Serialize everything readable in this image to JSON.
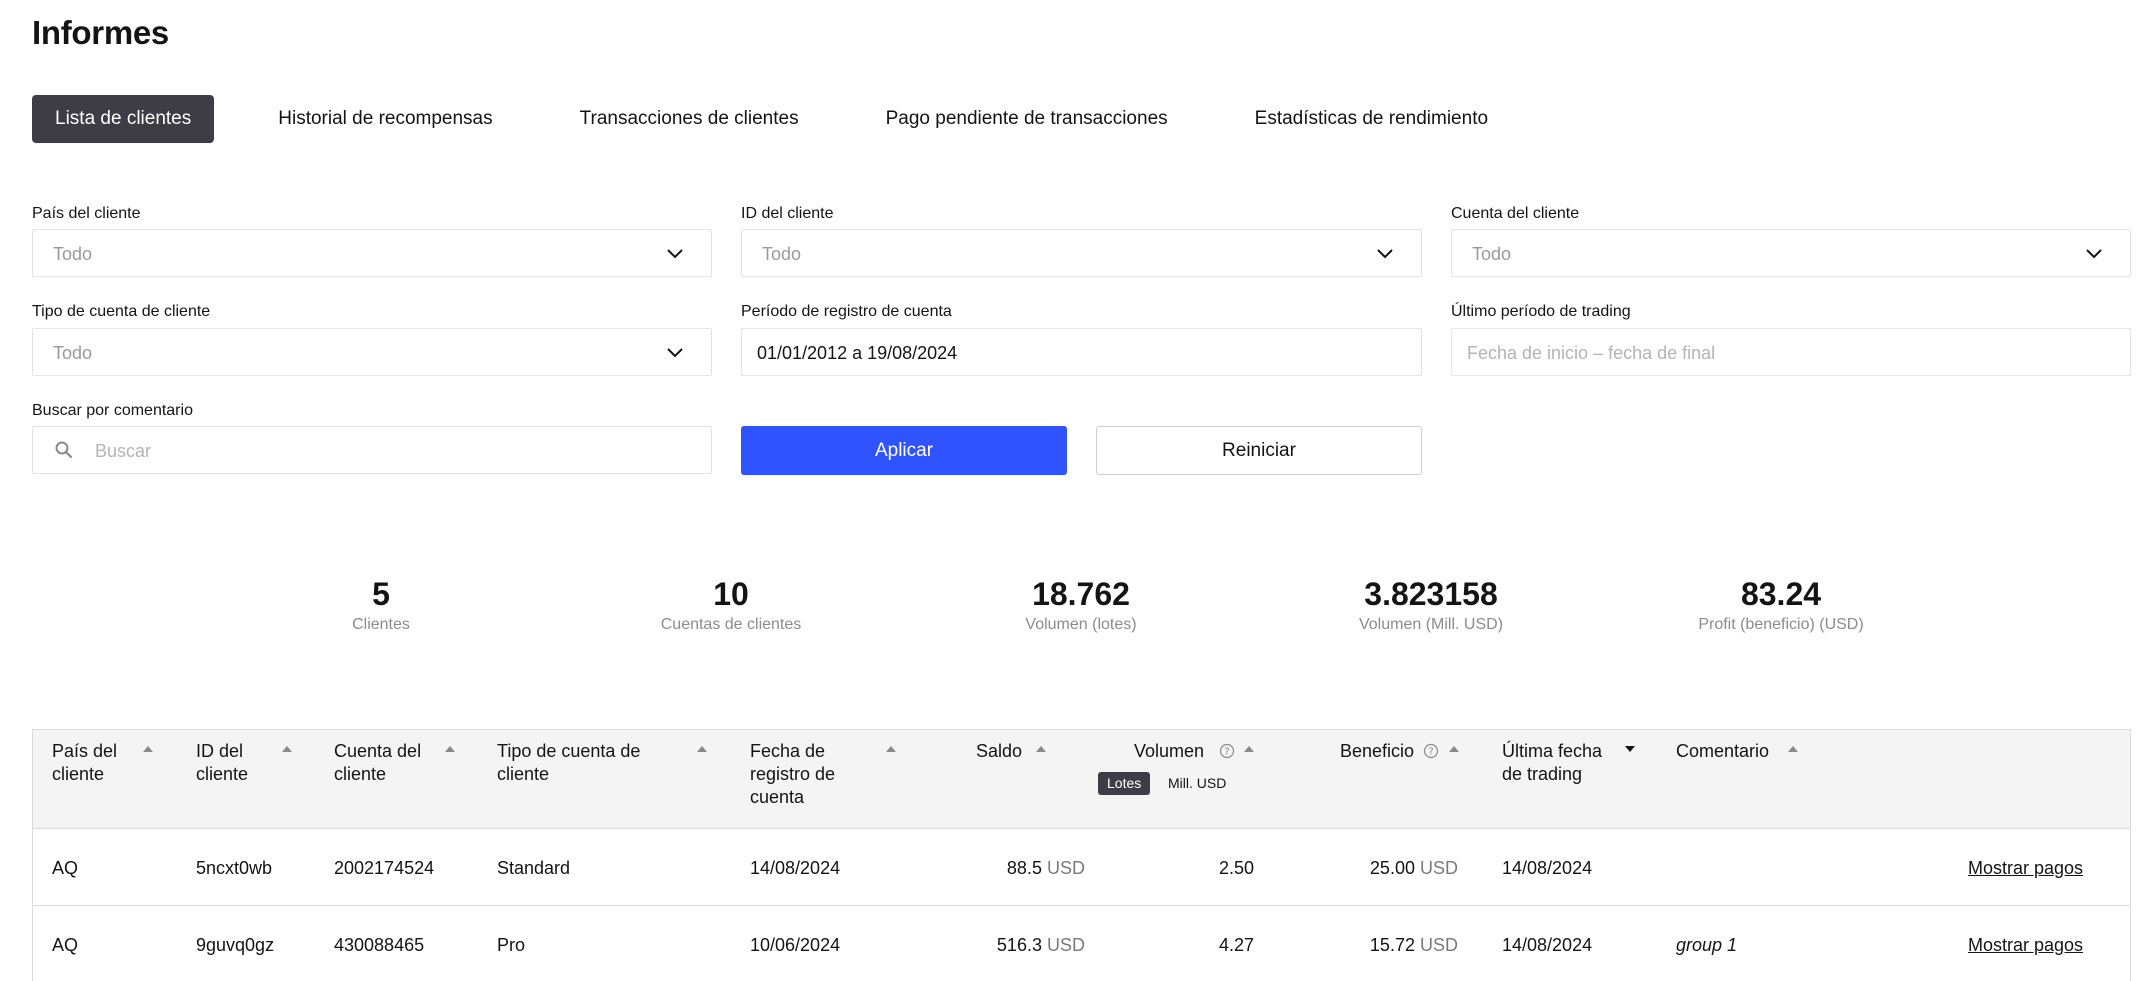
{
  "title": "Informes",
  "tabs": [
    {
      "label": "Lista de clientes",
      "active": true
    },
    {
      "label": "Historial de recompensas",
      "active": false
    },
    {
      "label": "Transacciones de clientes",
      "active": false
    },
    {
      "label": "Pago pendiente de transacciones",
      "active": false
    },
    {
      "label": "Estadísticas de rendimiento",
      "active": false
    }
  ],
  "filters": {
    "country": {
      "label": "País del cliente",
      "value": "Todo"
    },
    "client_id": {
      "label": "ID del cliente",
      "value": "Todo"
    },
    "account": {
      "label": "Cuenta del cliente",
      "value": "Todo"
    },
    "account_type": {
      "label": "Tipo de cuenta de cliente",
      "value": "Todo"
    },
    "registration_period": {
      "label": "Período de registro de cuenta",
      "value": "01/01/2012 a 19/08/2024"
    },
    "last_trading_period": {
      "label": "Último período de trading",
      "placeholder": "Fecha de inicio – fecha de final"
    },
    "comment_search": {
      "label": "Buscar por comentario",
      "placeholder": "Buscar"
    }
  },
  "buttons": {
    "apply": "Aplicar",
    "reset": "Reiniciar"
  },
  "stats": [
    {
      "value": "5",
      "label": "Clientes"
    },
    {
      "value": "10",
      "label": "Cuentas de clientes"
    },
    {
      "value": "18.762",
      "label": "Volumen (lotes)"
    },
    {
      "value": "3.823158",
      "label": "Volumen (Mill. USD)"
    },
    {
      "value": "83.24",
      "label": "Profit (beneficio) (USD)"
    }
  ],
  "table": {
    "headers": {
      "country": "País del cliente",
      "client_id": "ID del cliente",
      "account": "Cuenta del cliente",
      "account_type": "Tipo de cuenta de cliente",
      "registration_date": "Fecha de registro de cuenta",
      "balance": "Saldo",
      "volume": "Volumen",
      "profit": "Beneficio",
      "last_trading_date": "Última fecha de trading",
      "comment": "Comentario"
    },
    "volume_units": {
      "lots": "Lotes",
      "mill_usd": "Mill. USD",
      "active": "Lotes"
    },
    "sorted_column": "last_trading_date",
    "currency": "USD",
    "rows": [
      {
        "country": "AQ",
        "client_id": "5ncxt0wb",
        "account": "2002174524",
        "account_type": "Standard",
        "registration_date": "14/08/2024",
        "balance": "88.5",
        "volume": "2.50",
        "profit": "25.00",
        "last_trading_date": "14/08/2024",
        "comment": "",
        "action": "Mostrar pagos"
      },
      {
        "country": "AQ",
        "client_id": "9guvq0gz",
        "account": "430088465",
        "account_type": "Pro",
        "registration_date": "10/06/2024",
        "balance": "516.3",
        "volume": "4.27",
        "profit": "15.72",
        "last_trading_date": "14/08/2024",
        "comment": "group 1",
        "action": "Mostrar pagos"
      }
    ]
  }
}
